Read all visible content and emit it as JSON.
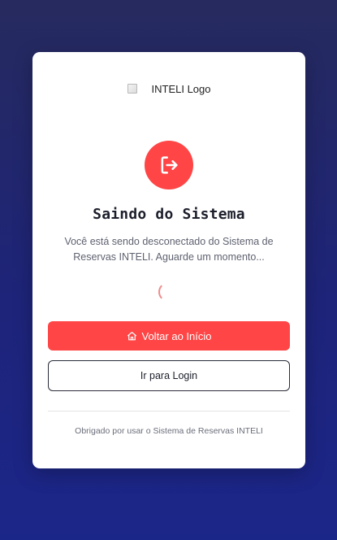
{
  "logo": {
    "alt_text": "INTELI Logo"
  },
  "header": {
    "title": "Saindo do Sistema",
    "message": "Você está sendo desconectado do Sistema de Reservas INTELI. Aguarde um momento..."
  },
  "icons": {
    "status": "logout-icon",
    "loading": "loading-spinner",
    "home": "home-icon"
  },
  "buttons": {
    "home_label": "Voltar ao Início",
    "login_label": "Ir para Login"
  },
  "footer": {
    "text": "Obrigado por usar o Sistema de Reservas INTELI"
  },
  "colors": {
    "accent": "#ff4545",
    "background_top": "#262a5e",
    "background_bottom": "#1b2689",
    "card": "#ffffff",
    "title_text": "#1c1f2b"
  }
}
